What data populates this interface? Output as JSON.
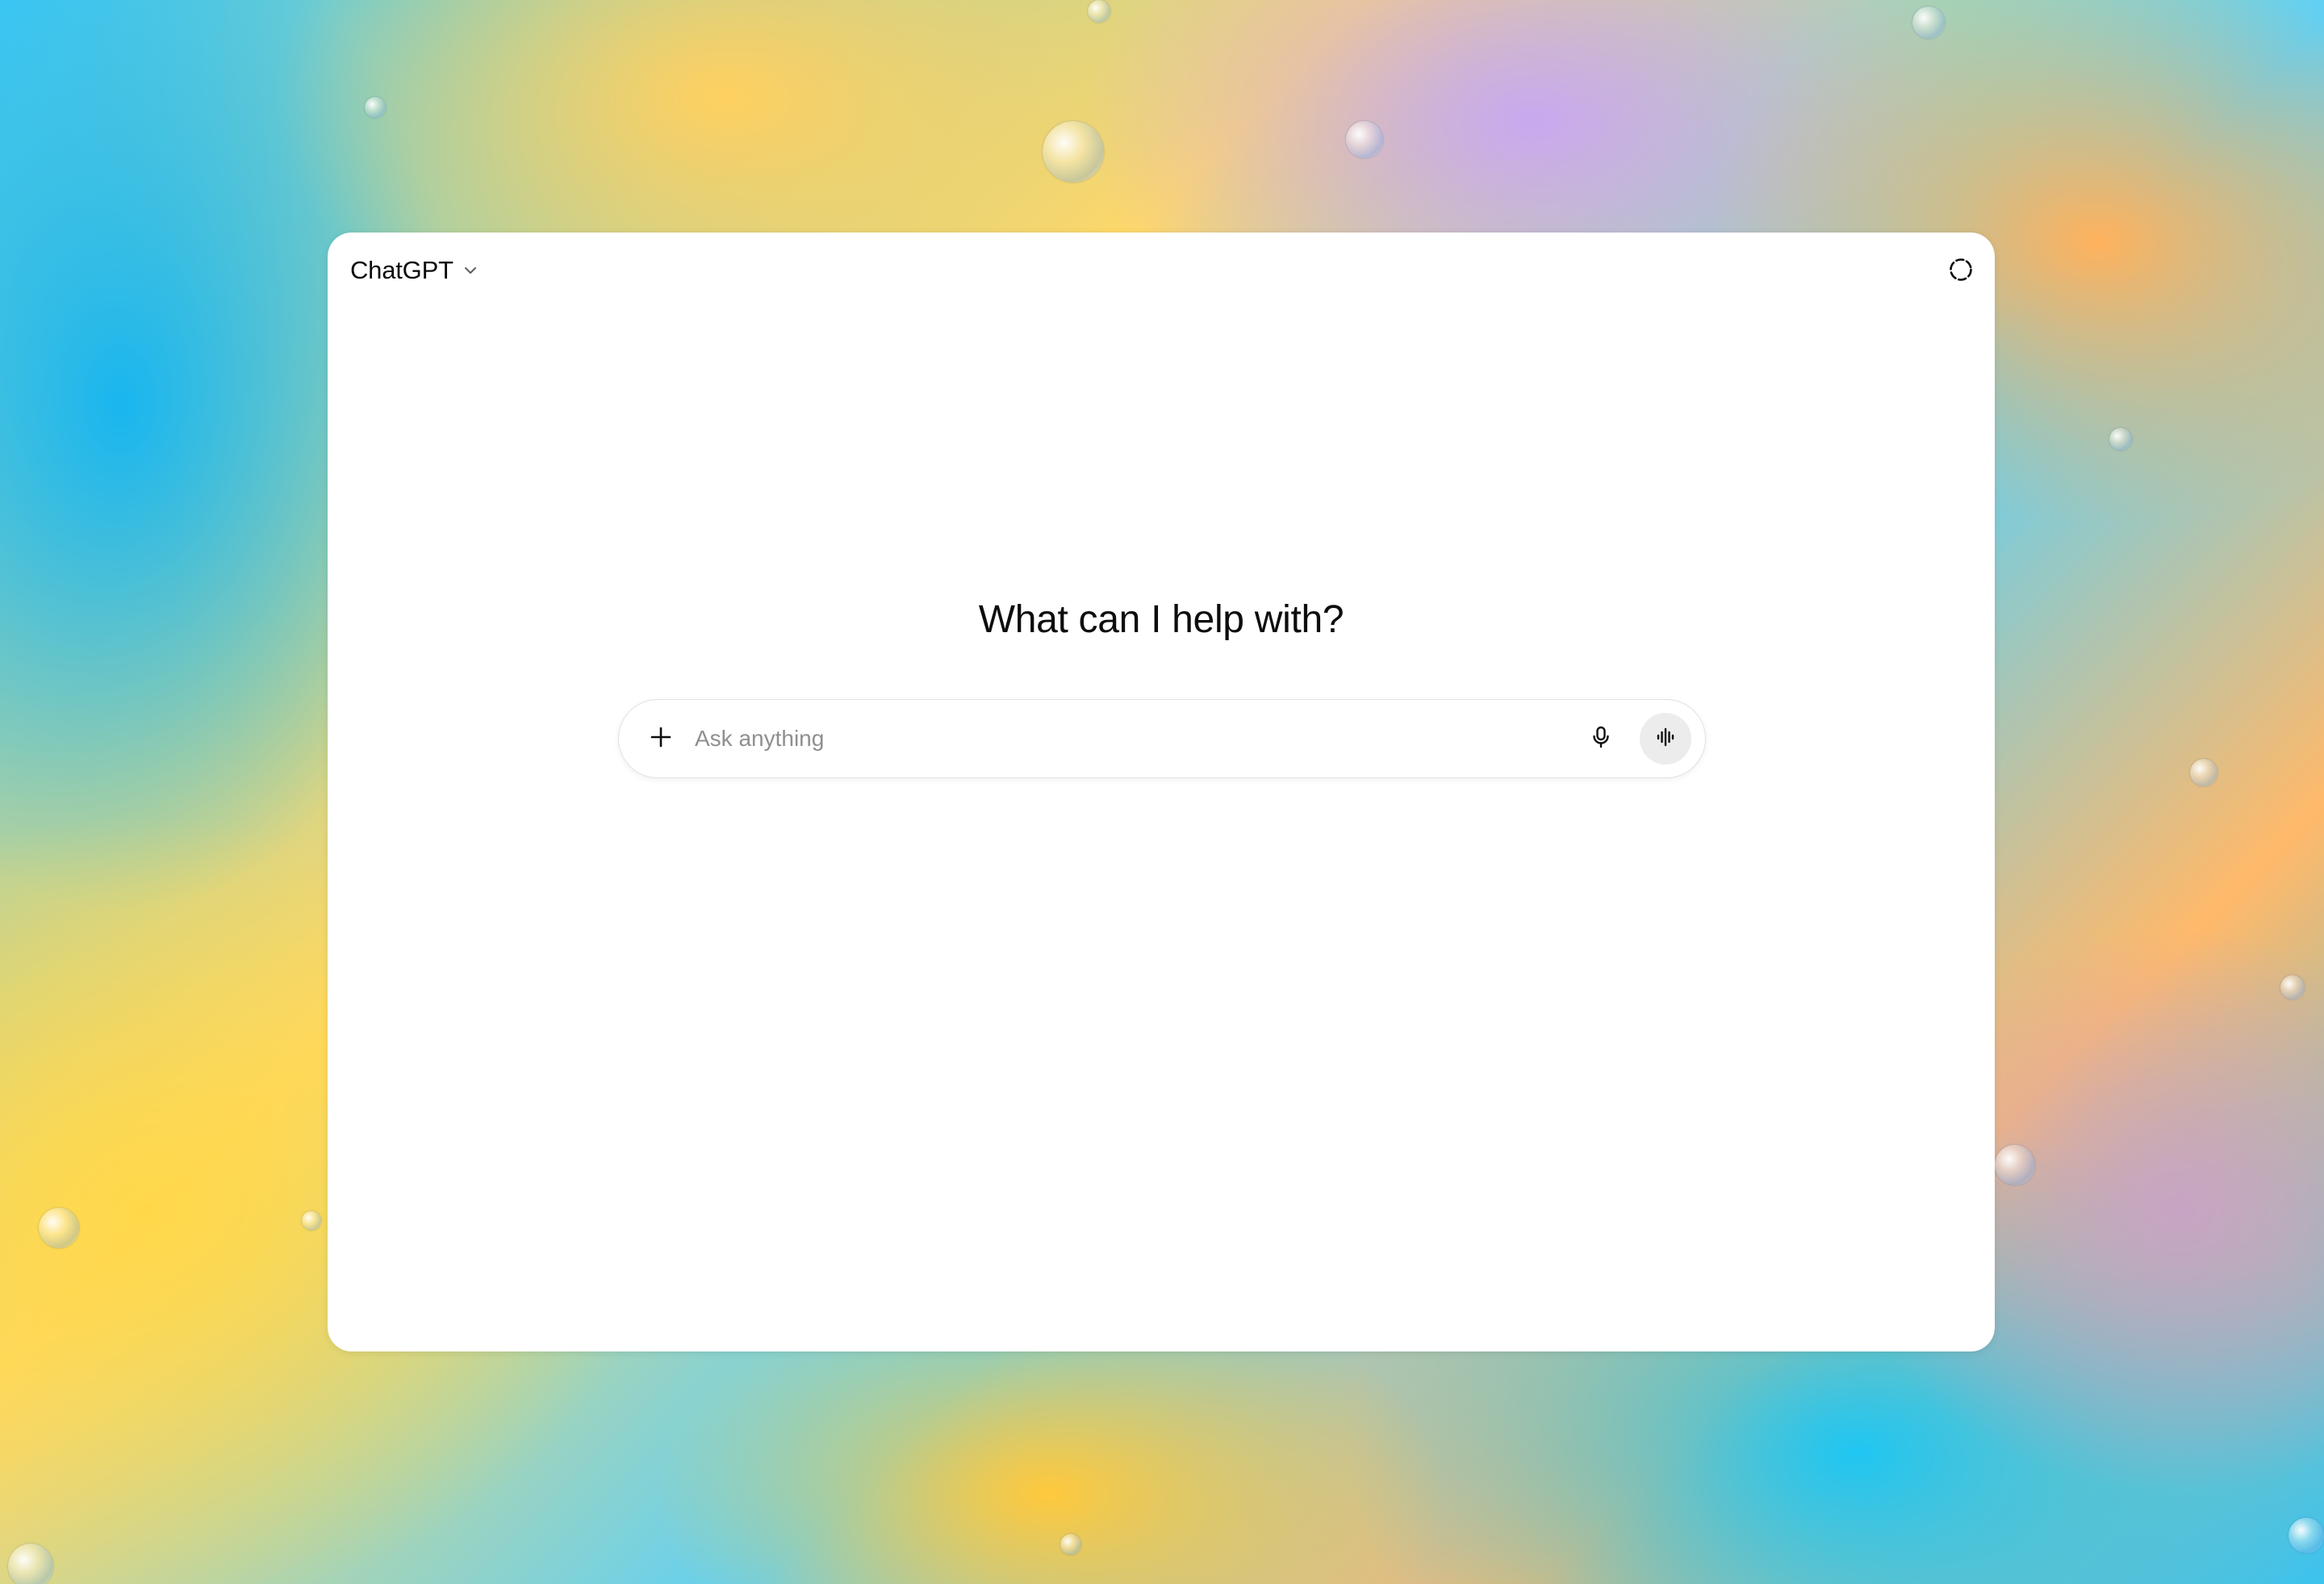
{
  "app": {
    "model_name": "ChatGPT"
  },
  "main": {
    "headline": "What can I help with?"
  },
  "composer": {
    "placeholder": "Ask anything",
    "value": ""
  },
  "icons": {
    "model_dropdown": "chevron-down-icon",
    "top_right": "dashed-circle-icon",
    "attach": "plus-icon",
    "dictate": "microphone-icon",
    "voice_mode": "voice-waveform-icon"
  },
  "colors": {
    "window_bg": "#ffffff",
    "text_primary": "#0d0d0d",
    "placeholder": "#8f8f8f",
    "voice_button_bg": "#ececec",
    "composer_border": "#e1e1e1"
  }
}
